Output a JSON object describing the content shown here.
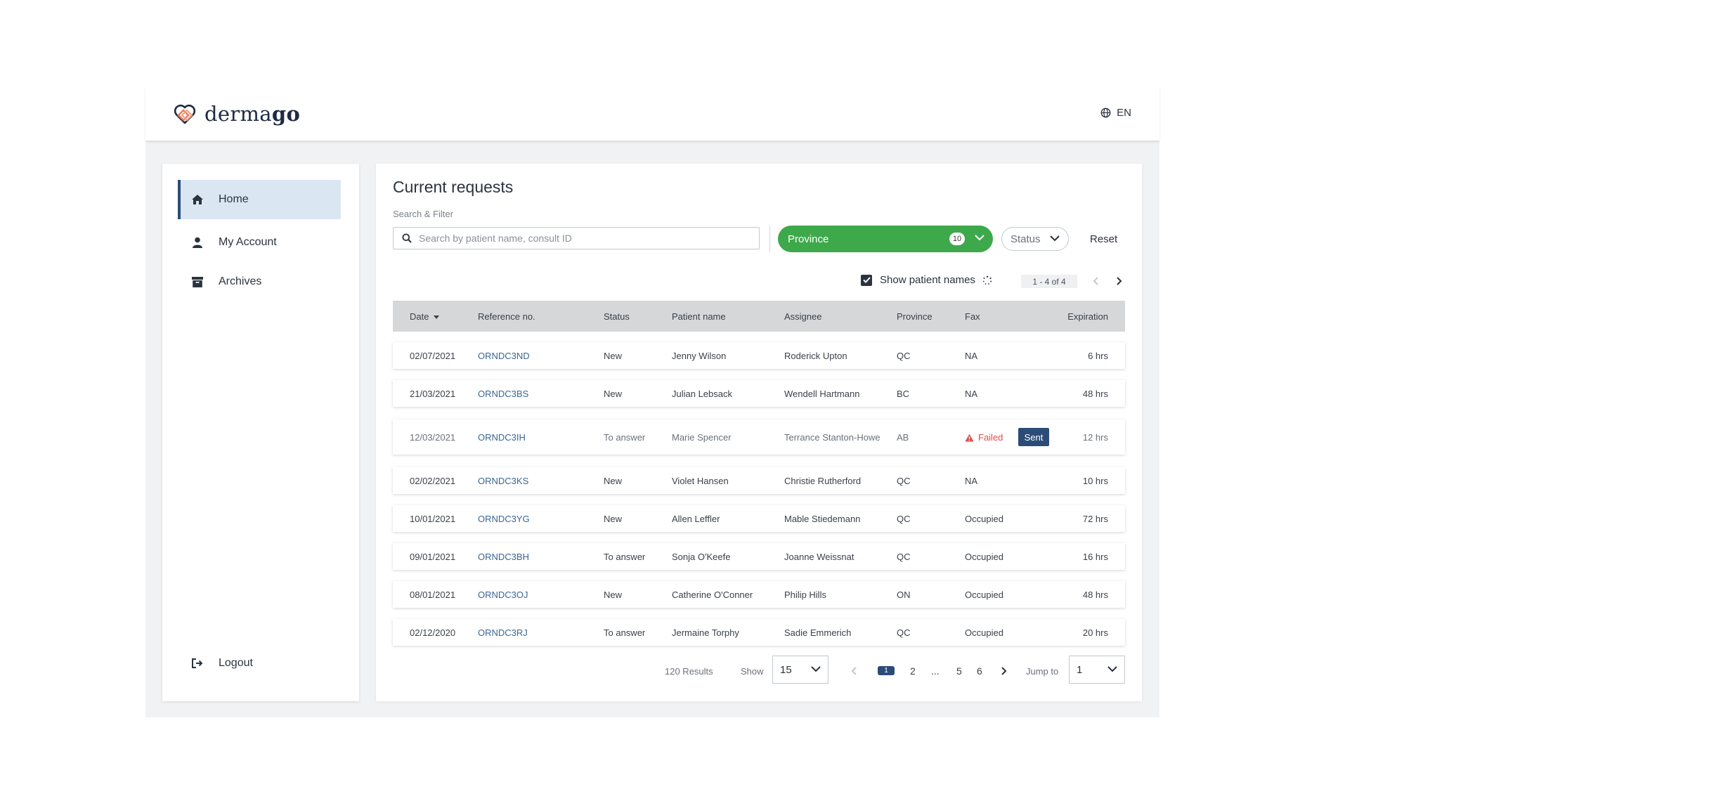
{
  "header": {
    "brand": {
      "text_a": "derma",
      "text_b": "go"
    },
    "language": "EN"
  },
  "sidebar": {
    "items": [
      {
        "label": "Home",
        "icon": "home-icon",
        "active": true
      },
      {
        "label": "My Account",
        "icon": "user-icon",
        "active": false
      },
      {
        "label": "Archives",
        "icon": "archive-icon",
        "active": false
      }
    ],
    "logout": {
      "label": "Logout",
      "icon": "logout-icon"
    }
  },
  "main": {
    "title": "Current requests",
    "filter_label": "Search & Filter",
    "search": {
      "placeholder": "Search by patient name, consult ID",
      "value": ""
    },
    "province": {
      "label": "Province",
      "count": "10"
    },
    "status": {
      "label": "Status"
    },
    "reset_label": "Reset",
    "show_patient_names": {
      "label": "Show patient names",
      "checked": true
    },
    "mini_pager": "1 - 4 of 4"
  },
  "table": {
    "columns": [
      "Date",
      "Reference no.",
      "Status",
      "Patient name",
      "Assignee",
      "Province",
      "Fax",
      "Expiration"
    ],
    "rows": [
      {
        "date": "02/07/2021",
        "ref": "ORNDC3ND",
        "status": "New",
        "patient": "Jenny Wilson",
        "assignee": "Roderick Upton",
        "province": "QC",
        "fax": "NA",
        "expiration": "6 hrs"
      },
      {
        "date": "21/03/2021",
        "ref": "ORNDC3BS",
        "status": "New",
        "patient": "Julian Lebsack",
        "assignee": "Wendell Hartmann",
        "province": "BC",
        "fax": "NA",
        "expiration": "48 hrs"
      },
      {
        "date": "12/03/2021",
        "ref": "ORNDC3IH",
        "status": "To answer",
        "patient": "Marie Spencer",
        "assignee": "Terrance Stanton-Howe",
        "province": "AB",
        "fax": "Failed",
        "fax_action": "Sent",
        "expiration": "12 hrs"
      },
      {
        "date": "02/02/2021",
        "ref": "ORNDC3KS",
        "status": "New",
        "patient": "Violet Hansen",
        "assignee": "Christie Rutherford",
        "province": "QC",
        "fax": "NA",
        "expiration": "10 hrs"
      },
      {
        "date": "10/01/2021",
        "ref": "ORNDC3YG",
        "status": "New",
        "patient": "Allen Leffler",
        "assignee": "Mable Stiedemann",
        "province": "QC",
        "fax": "Occupied",
        "expiration": "72 hrs"
      },
      {
        "date": "09/01/2021",
        "ref": "ORNDC3BH",
        "status": "To answer",
        "patient": "Sonja O'Keefe",
        "assignee": "Joanne Weissnat",
        "province": "QC",
        "fax": "Occupied",
        "expiration": "16 hrs"
      },
      {
        "date": "08/01/2021",
        "ref": "ORNDC3OJ",
        "status": "New",
        "patient": "Catherine O'Conner",
        "assignee": "Philip Hills",
        "province": "ON",
        "fax": "Occupied",
        "expiration": "48 hrs"
      },
      {
        "date": "02/12/2020",
        "ref": "ORNDC3RJ",
        "status": "To answer",
        "patient": "Jermaine Torphy",
        "assignee": "Sadie Emmerich",
        "province": "QC",
        "fax": "Occupied",
        "expiration": "20 hrs"
      }
    ]
  },
  "footer": {
    "results": "120 Results",
    "show_label": "Show",
    "page_size": "15",
    "pages": [
      "1",
      "2",
      "...",
      "5",
      "6"
    ],
    "jump_label": "Jump to",
    "jump_value": "1"
  },
  "colors": {
    "accent": "#2c4c78",
    "province_green": "#3ea94b",
    "failed_red": "#e34b4b"
  }
}
